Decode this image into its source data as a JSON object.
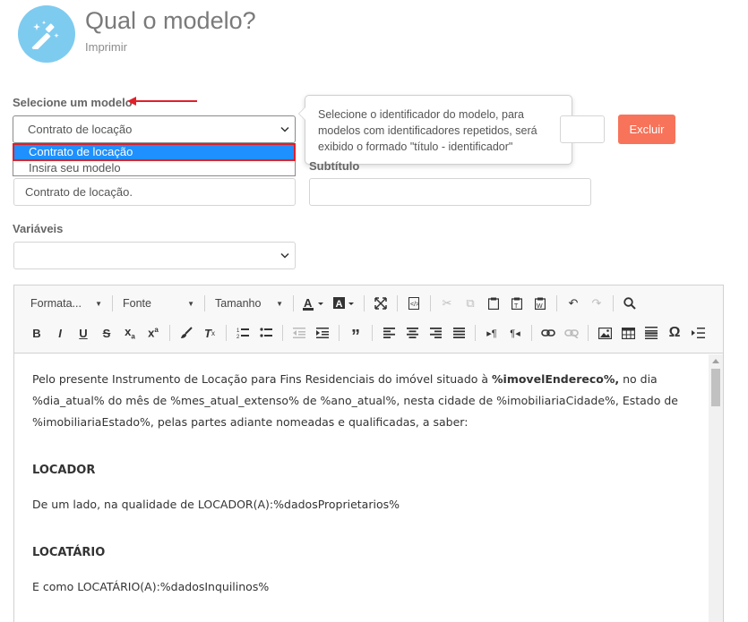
{
  "header": {
    "title": "Qual o modelo?",
    "subtitle": "Imprimir",
    "icon": "magic-wand-icon"
  },
  "form": {
    "model_label": "Selecione um modelo",
    "model_value": "Contrato de locação",
    "model_options": [
      "Contrato de locação",
      "Insira seu modelo"
    ],
    "title_value": "Contrato de locação.",
    "subtitle_label": "Subtítulo",
    "subtitle_value": "",
    "variables_label": "Variáveis",
    "variables_value": "",
    "identifier_value": "",
    "delete_label": "Excluir"
  },
  "tooltip": {
    "text": "Selecione o identificador do modelo, para modelos com identificadores repetidos, será exibido o formado \"título - identificador\""
  },
  "toolbar": {
    "format_label": "Formata...",
    "font_label": "Fonte",
    "size_label": "Tamanho"
  },
  "editor": {
    "paragraph1_a": "Pelo presente Instrumento de Locação para Fins Residenciais do imóvel situado à ",
    "paragraph1_bold": "%imovelEndereco%,",
    "paragraph1_b": " no dia %dia_atual% do mês de %mes_atual_extenso% de %ano_atual%, nesta cidade de %imobiliariaCidade%, Estado de %imobiliariaEstado%, pelas partes adiante nomeadas e qualificadas, a saber:",
    "heading_locador": "LOCADOR",
    "locador_text": "De um lado, na qualidade de LOCADOR(A):%dadosProprietarios%",
    "heading_locatario": "LOCATÁRIO",
    "locatario_text": "E como LOCATÁRIO(A):%dadosInquilinos%"
  },
  "colors": {
    "accent_icon_bg": "#7ecbf0",
    "delete_button": "#f7735a",
    "selected_option": "#1e90ff",
    "highlight_outline": "#e0202a"
  }
}
